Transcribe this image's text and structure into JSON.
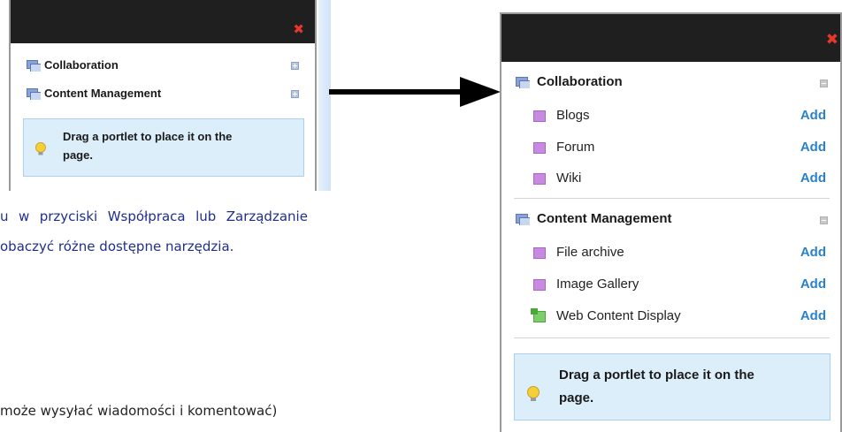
{
  "small_panel": {
    "close_glyph": "✖",
    "categories": [
      {
        "label": "Collaboration",
        "toggle": "expand-icon"
      },
      {
        "label": "Content Management",
        "toggle": "expand-icon"
      }
    ],
    "hint": {
      "line1": "Drag a portlet to place it on the",
      "line2": "page."
    }
  },
  "large_panel": {
    "close_glyph": "✖",
    "categories": [
      {
        "label": "Collaboration",
        "toggle": "collapse-icon",
        "items": [
          {
            "label": "Blogs",
            "action": "Add"
          },
          {
            "label": "Forum",
            "action": "Add"
          },
          {
            "label": "Wiki",
            "action": "Add"
          }
        ]
      },
      {
        "label": "Content Management",
        "toggle": "collapse-icon",
        "items": [
          {
            "label": "File archive",
            "action": "Add"
          },
          {
            "label": "Image Gallery",
            "action": "Add"
          },
          {
            "label": "Web Content Display",
            "action": "Add"
          }
        ]
      }
    ],
    "hint": {
      "line1": "Drag a portlet to place it on the",
      "line2": "page."
    }
  },
  "body_text": {
    "line1_words": [
      "u",
      "w",
      "przyciski",
      "Współpraca",
      "lub",
      "Zarządzanie"
    ],
    "line2": "obaczyć różne dostępne narzędzia.",
    "line3": "może wysyłać wiadomości i komentować)"
  },
  "colors": {
    "titlebar": "#1f1f1f",
    "close": "#e5372c",
    "add_link": "#2b82c9",
    "hint_bg": "#ddeefb",
    "body_text": "#1f2f8a"
  }
}
